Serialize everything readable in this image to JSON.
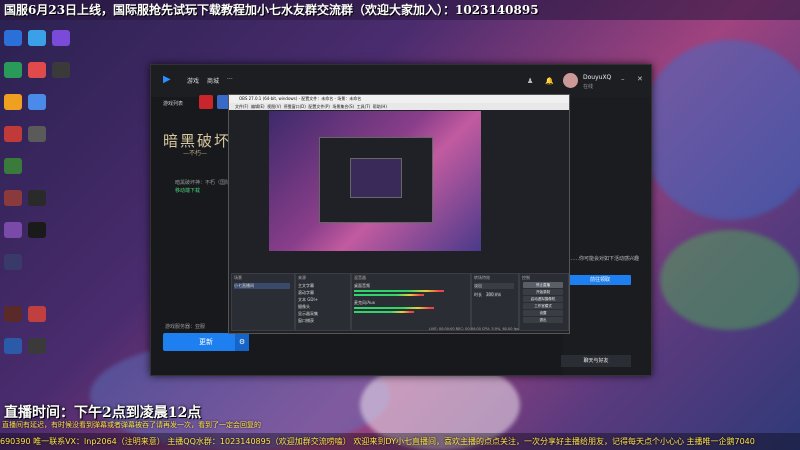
{
  "top_banner": "国服6月23日上线，国际服抢先试玩下载教程加小七水友群交流群（欢迎大家加入）：1023140895",
  "live_time": "直播时间：下午2点到凌晨12点",
  "yellow_note": "直播间有延迟，有时候没看到弹幕或者弹幕被吞了请再发一次，看到了一定会回复的",
  "ticker": "690390  唯一联系VX：lnp2064（注明来意） 主播QQ水群：1023140895（欢迎加群交流唠嗑）    欢迎来到DY小七直播间，喜欢主播的点点关注，一次分享好主播给朋友，记得每天点个小心心     主播唯一企鹅7040",
  "desktop_icons": [
    {
      "label": "",
      "color": "#2b6fd8"
    },
    {
      "label": "",
      "color": "#3aa0e8"
    },
    {
      "label": "",
      "color": "#7a4ad8"
    },
    {
      "label": "",
      "color": "#2a9a5a"
    },
    {
      "label": "",
      "color": "#e04a4a"
    },
    {
      "label": "",
      "color": "#3a3a3a"
    },
    {
      "label": "",
      "color": "#f0a020"
    },
    {
      "label": "",
      "color": "#4a8ae8"
    }
  ],
  "window": {
    "nav": [
      "游戏",
      "商城",
      "···"
    ],
    "user_name": "DouyuXQ",
    "user_sub": "在线",
    "sidebar_label": "游戏列表",
    "game_title": "暗黑破坏神",
    "game_subtitle": "—不朽—",
    "meta_line1": "暗黑破坏神：不朽（国际服）",
    "meta_line2": "移动端下载",
    "region_label": "游戏服务器：亚服",
    "start_button": "更新",
    "settings_icon": "gear-icon",
    "right_text": "……你可能会对如下活动感兴趣",
    "right_button": "前往领取",
    "enter_button": "聊天与好友",
    "accent": "#1d7ff0"
  },
  "obs": {
    "title": "OBS 27.0.1 (64-bit, windows) - 配置文件：未命名 - 场景：未命名",
    "menu": [
      "文件(F)",
      "编辑(E)",
      "视图(V)",
      "停靠窗口(D)",
      "配置文件(P)",
      "场景集合(S)",
      "工具(T)",
      "帮助(H)"
    ],
    "scene_header": "场景",
    "scene_item": "小七直播间",
    "sources_header": "来源",
    "sources": [
      "主文字幕",
      "滚动字幕",
      "文本 GDI+",
      "摄像头",
      "显示器采集",
      "窗口捕获"
    ],
    "mixer_header": "混音器",
    "mixer_items": [
      "桌面音频",
      "麦克风/Aux"
    ],
    "transition_header": "转场特效",
    "transition_value": "淡出",
    "duration_label": "时长",
    "duration_value": "300 ms",
    "controls_header": "控制",
    "controls": [
      "停止直播",
      "开始录制",
      "启动虚拟摄像机",
      "工作室模式",
      "设置",
      "退出"
    ],
    "status": "LIVE: 00:00:00  REC: 00:00:00  CPU: 3.9%, 60.00 fps"
  }
}
